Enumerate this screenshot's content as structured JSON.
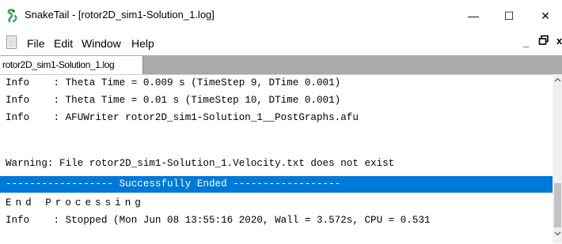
{
  "window": {
    "title": "SnakeTail - [rotor2D_sim1-Solution_1.log]",
    "minimize_glyph": "—",
    "maximize_glyph": "☐",
    "close_glyph": "✕"
  },
  "menu": {
    "items": [
      "File",
      "Edit",
      "Window",
      "Help"
    ],
    "mdi_minimize_glyph": "_",
    "mdi_close_glyph": "x"
  },
  "tabs": [
    {
      "label": "rotor2D_sim1-Solution_1.log",
      "active": true
    }
  ],
  "log": {
    "lines": [
      {
        "text": "Info    : Theta Time = 0.009 s (TimeStep 9, DTime 0.001)",
        "style": "normal"
      },
      {
        "text": "Info    : Theta Time = 0.01 s (TimeStep 10, DTime 0.001)",
        "style": "normal"
      },
      {
        "text": "Info    : AFUWriter rotor2D_sim1-Solution_1__PostGraphs.afu",
        "style": "normal"
      },
      {
        "text": "",
        "style": "normal"
      },
      {
        "text": "Warning: File rotor2D_sim1-Solution_1.Velocity.txt does not exist",
        "style": "normal"
      },
      {
        "text": "------------------ Successfully Ended ------------------",
        "style": "highlight"
      },
      {
        "text": "End Processing",
        "style": "spaced"
      },
      {
        "text": "Info    : Stopped (Mon Jun 08 13:55:16 2020, Wall = 3.572s, CPU = 0.531",
        "style": "normal"
      }
    ]
  },
  "colors": {
    "highlight_bg": "#0078d7",
    "highlight_fg": "#ffffff",
    "tabstrip_bg": "#aaaaaa",
    "scrollbar_thumb": "#c2c2c2",
    "app_icon_green": "#3aa655"
  },
  "icons": {
    "app": "snake-icon",
    "document": "document-icon",
    "restore": "restore-icon",
    "scroll_up": "scroll-up-arrow-icon",
    "scroll_down": "scroll-down-arrow-icon"
  }
}
